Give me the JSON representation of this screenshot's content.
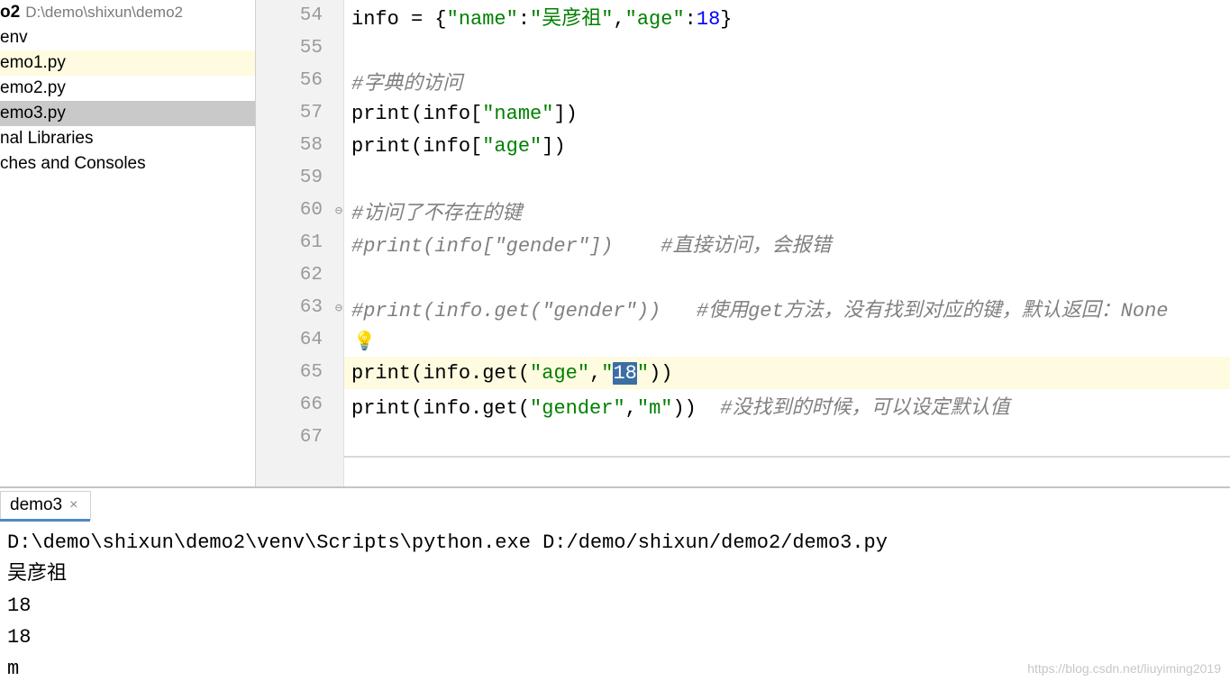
{
  "sidebar": {
    "root": {
      "name": "o2",
      "path": "D:\\demo\\shixun\\demo2"
    },
    "items": [
      "env",
      "emo1.py",
      "emo2.py",
      "emo3.py",
      "nal Libraries",
      "ches and Consoles"
    ],
    "selected_index": 3
  },
  "editor": {
    "highlight_line": 65,
    "bulb_line": 64,
    "selection": {
      "line": 65,
      "text": "18"
    },
    "lines": [
      {
        "n": 54,
        "seg": [
          [
            "kw",
            "info = {"
          ],
          [
            "str",
            "\"name\""
          ],
          [
            "kw",
            ":"
          ],
          [
            "str",
            "\"吴彦祖\""
          ],
          [
            "kw",
            ","
          ],
          [
            "str",
            "\"age\""
          ],
          [
            "kw",
            ":"
          ],
          [
            "num",
            "18"
          ],
          [
            "kw",
            "}"
          ]
        ]
      },
      {
        "n": 55,
        "seg": []
      },
      {
        "n": 56,
        "seg": [
          [
            "cmt",
            "#字典的访问"
          ]
        ]
      },
      {
        "n": 57,
        "seg": [
          [
            "call",
            "print"
          ],
          [
            "kw",
            "("
          ],
          [
            "kw",
            "info["
          ],
          [
            "str",
            "\"name\""
          ],
          [
            "kw",
            "])"
          ]
        ]
      },
      {
        "n": 58,
        "seg": [
          [
            "call",
            "print"
          ],
          [
            "kw",
            "("
          ],
          [
            "kw",
            "info["
          ],
          [
            "str",
            "\"age\""
          ],
          [
            "kw",
            "])"
          ]
        ]
      },
      {
        "n": 59,
        "seg": []
      },
      {
        "n": 60,
        "seg": [
          [
            "cmt",
            "#访问了不存在的键"
          ]
        ],
        "fold": true
      },
      {
        "n": 61,
        "seg": [
          [
            "cmt",
            "#print(info[\"gender\"])    #直接访问，会报错"
          ]
        ]
      },
      {
        "n": 62,
        "seg": []
      },
      {
        "n": 63,
        "seg": [
          [
            "cmt",
            "#print(info.get(\"gender\"))   #使用get方法，没有找到对应的键，默认返回：None"
          ]
        ],
        "fold": true
      },
      {
        "n": 64,
        "seg": []
      },
      {
        "n": 65,
        "seg": [
          [
            "call",
            "print"
          ],
          [
            "kw",
            "(info.get("
          ],
          [
            "str",
            "\"age\""
          ],
          [
            "kw",
            ","
          ],
          [
            "str",
            "\""
          ],
          [
            "sel",
            "18"
          ],
          [
            "str",
            "\""
          ],
          [
            "kw",
            "))"
          ]
        ]
      },
      {
        "n": 66,
        "seg": [
          [
            "call",
            "print"
          ],
          [
            "kw",
            "(info.get("
          ],
          [
            "str",
            "\"gender\""
          ],
          [
            "kw",
            ","
          ],
          [
            "str",
            "\"m\""
          ],
          [
            "kw",
            "))  "
          ],
          [
            "cmt",
            "#没找到的时候，可以设定默认值"
          ]
        ]
      },
      {
        "n": 67,
        "seg": []
      }
    ]
  },
  "console": {
    "tab_label": "demo3",
    "output": [
      "D:\\demo\\shixun\\demo2\\venv\\Scripts\\python.exe D:/demo/shixun/demo2/demo3.py",
      "吴彦祖",
      "18",
      "18",
      "m"
    ]
  },
  "watermark": "https://blog.csdn.net/liuyiming2019"
}
